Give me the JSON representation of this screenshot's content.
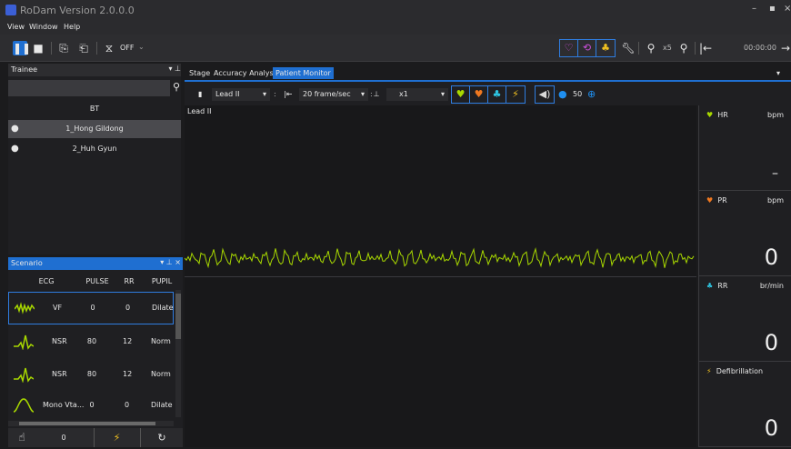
{
  "app": {
    "title": "RoDam Version 2.0.0.0"
  },
  "menu": [
    "View",
    "Window",
    "Help"
  ],
  "toolbar": {
    "sync_label": "OFF",
    "zoom_level": "x5",
    "time": "00:00:00"
  },
  "trainee_panel": {
    "title": "Trainee",
    "column_header": "BT",
    "items": [
      {
        "name": "1_Hong Gildong",
        "selected": true
      },
      {
        "name": "2_Huh Gyun",
        "selected": false
      }
    ]
  },
  "scenario_panel": {
    "title": "Scenario",
    "columns": [
      "ECG",
      "PULSE",
      "RR",
      "PUPIL"
    ],
    "rows": [
      {
        "ecg": "VF",
        "pulse": "0",
        "rr": "0",
        "pupil": "Dilate",
        "selected": true
      },
      {
        "ecg": "NSR",
        "pulse": "80",
        "rr": "12",
        "pupil": "Norm",
        "selected": false
      },
      {
        "ecg": "NSR",
        "pulse": "80",
        "rr": "12",
        "pupil": "Norm",
        "selected": false
      },
      {
        "ecg": "Mono Vta...",
        "pulse": "0",
        "rr": "0",
        "pupil": "Dilate",
        "selected": false
      }
    ],
    "bottom_count": "0"
  },
  "tabs": [
    {
      "label": "Stage",
      "active": false
    },
    {
      "label": "Accuracy Analysis",
      "active": false
    },
    {
      "label": "Patient Monitor",
      "active": true
    }
  ],
  "monitor_toolbar": {
    "lead": "Lead II",
    "speed": "20 frame/sec",
    "gain": "x1",
    "volume": "50"
  },
  "ecg": {
    "lead_label": "Lead II"
  },
  "vitals": [
    {
      "label": "HR",
      "unit": "bpm",
      "value": "–",
      "icon": "heart-icon",
      "color": "#a8d800"
    },
    {
      "label": "PR",
      "unit": "bpm",
      "value": "0",
      "icon": "heart-icon",
      "color": "#f07820"
    },
    {
      "label": "RR",
      "unit": "br/min",
      "value": "0",
      "icon": "lungs-icon",
      "color": "#2ec4e0"
    },
    {
      "label": "Defibrillation",
      "unit": "",
      "value": "0",
      "icon": "lightning-icon",
      "color": "#f0c020"
    }
  ],
  "colors": {
    "accent": "#1f6fd1",
    "ecg_trace": "#a8d800"
  }
}
